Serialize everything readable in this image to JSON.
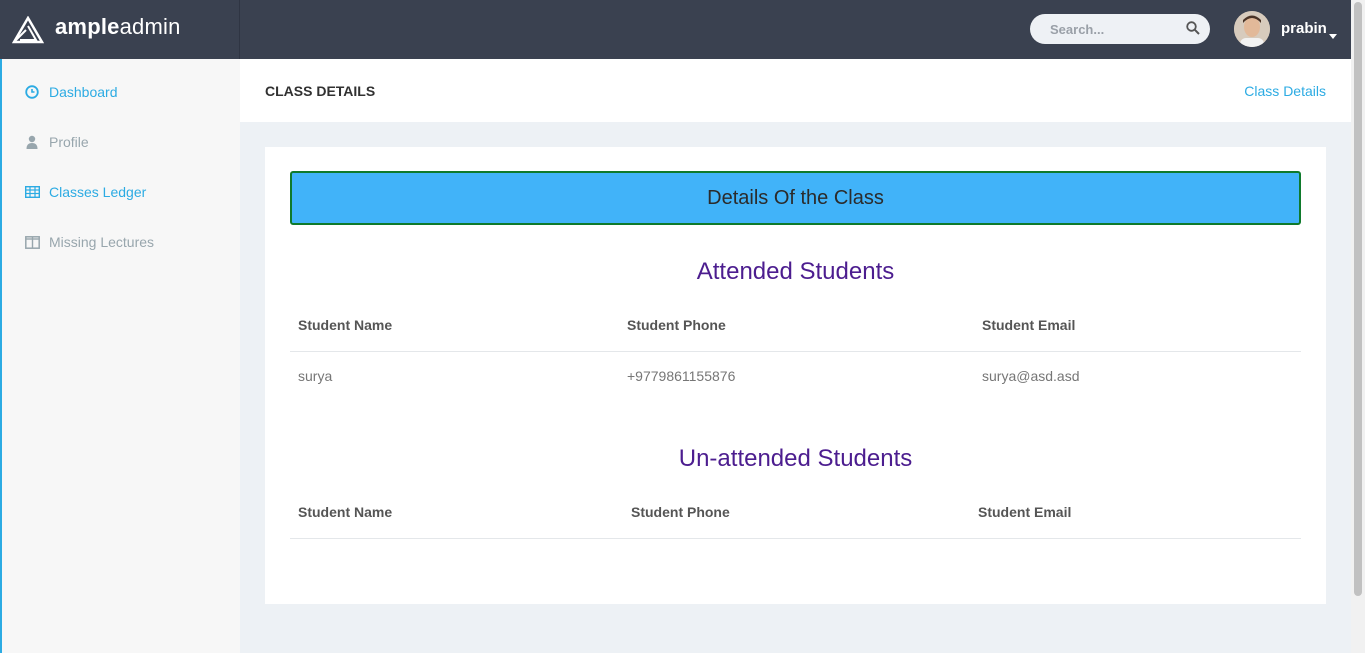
{
  "brand": {
    "bold": "ample",
    "light": "admin"
  },
  "search": {
    "placeholder": "Search..."
  },
  "user": {
    "name": "prabin"
  },
  "sidebar": {
    "items": [
      {
        "label": "Dashboard",
        "icon": "clock-icon"
      },
      {
        "label": "Profile",
        "icon": "user-icon"
      },
      {
        "label": "Classes Ledger",
        "icon": "table-icon"
      },
      {
        "label": "Missing Lectures",
        "icon": "columns-icon"
      }
    ]
  },
  "page": {
    "title": "CLASS DETAILS",
    "breadcrumb": "Class Details"
  },
  "card": {
    "banner": "Details Of the Class",
    "attended": {
      "title": "Attended Students",
      "headers": [
        "Student Name",
        "Student Phone",
        "Student Email"
      ],
      "rows": [
        [
          "surya",
          "+9779861155876",
          "surya@asd.asd"
        ]
      ]
    },
    "unattended": {
      "title": "Un-attended Students",
      "headers": [
        "Student Name",
        "Student Phone",
        "Student Email"
      ],
      "rows": []
    }
  },
  "colors": {
    "accent": "#2cabe3",
    "topbar": "#3a4150",
    "banner": "#41b3f9",
    "section_title": "#4c1d8f"
  }
}
